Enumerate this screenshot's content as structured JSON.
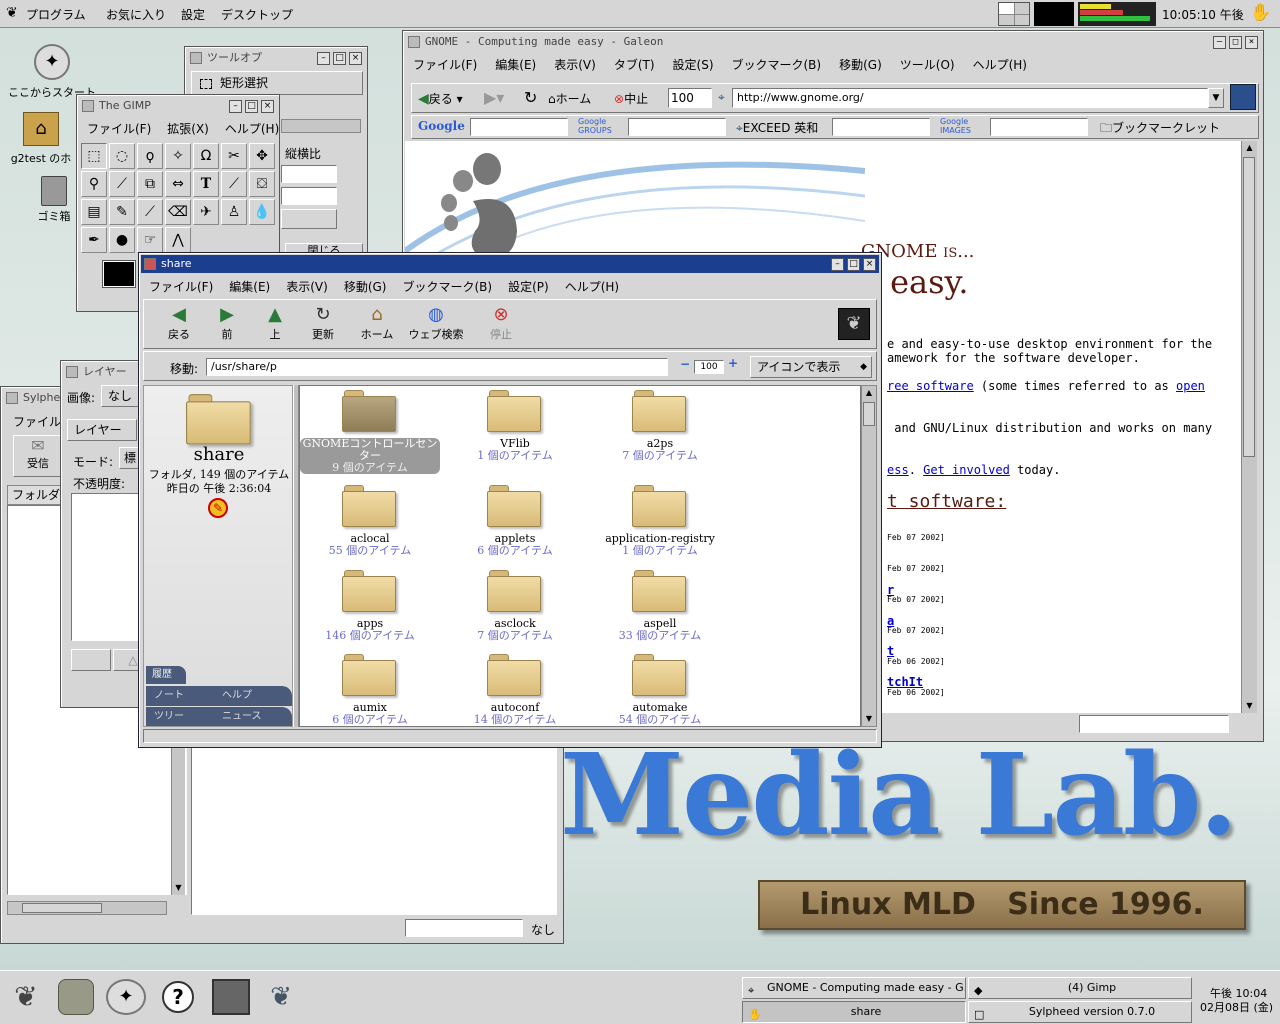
{
  "top_panel": {
    "menus": [
      "プログラム",
      "お気に入り",
      "設定",
      "デスクトップ"
    ],
    "clock": "10:05:10 午後"
  },
  "desktop": {
    "icons": [
      "ここからスタート",
      "g2test のホ",
      "ゴミ箱"
    ],
    "wallpaper_title": "Media Lab.",
    "wallpaper_plate": "Linux MLD   Since 1996."
  },
  "galeon": {
    "title": "GNOME - Computing made easy - Galeon",
    "menus": [
      "ファイル(F)",
      "編集(E)",
      "表示(V)",
      "タブ(T)",
      "設定(S)",
      "ブックマーク(B)",
      "移動(G)",
      "ツール(O)",
      "ヘルプ(H)"
    ],
    "back": "戻る",
    "home": "ホーム",
    "stop": "中止",
    "zoom": "100",
    "url": "http://www.gnome.org/",
    "search_bar": {
      "google": "Google",
      "google_groups": "Google GROUPS",
      "exceed": "EXCEED 英和",
      "google_images": "Google IMAGES",
      "bookmarklet": "ブックマークレット"
    },
    "content": {
      "heading": "GNOME is...",
      "heading2": "e easy.",
      "line1": "e and easy-to-use desktop environment for the",
      "line2": "amework for the software developer.",
      "line3_link": "ree software",
      "line3_rest": " (some times referred to as ",
      "line3_link2": "open",
      "line4": " and GNU/Linux distribution and works on many",
      "line5_link": "ess",
      "line5_mid": ". ",
      "line5_link2": "Get involved",
      "line5_rest": " today.",
      "section": "t software:",
      "dates": [
        "Feb 07 2002]",
        "Feb 07 2002]",
        "Feb 07 2002]",
        "Feb 07 2002]",
        "Feb 06 2002]",
        "Feb 06 2002]"
      ],
      "news_links": [
        "r",
        "a",
        "t",
        "tchIt"
      ]
    }
  },
  "gimp_toolopts": {
    "title": "ツールオプ",
    "rect_select": "矩形選択",
    "aspect": "縦横比",
    "close": "閉じる"
  },
  "gimp": {
    "title": "The GIMP",
    "menus": [
      "ファイル(F)",
      "拡張(X)",
      "ヘルプ(H)"
    ]
  },
  "layers": {
    "title": "レイヤー",
    "image_label": "画像:",
    "image_value": "なし",
    "layer_tab": "レイヤー",
    "mode_label": "モード:",
    "mode_value": "標",
    "opacity_label": "不透明度:"
  },
  "sylpheed": {
    "title": "Sylphe",
    "file_menu": "ファイル",
    "receive": "受信",
    "folder": "フォルダ",
    "status": "なし"
  },
  "nautilus": {
    "title": "share",
    "menus": [
      "ファイル(F)",
      "編集(E)",
      "表示(V)",
      "移動(G)",
      "ブックマーク(B)",
      "設定(P)",
      "ヘルプ(H)"
    ],
    "toolbar": [
      "戻る",
      "前",
      "上",
      "更新",
      "ホーム",
      "ウェブ検索",
      "停止"
    ],
    "location_label": "移動:",
    "location": "/usr/share/p",
    "zoom": "100",
    "view_mode": "アイコンで表示",
    "sidebar": {
      "name": "share",
      "info": "フォルダ, 149 個のアイテム",
      "date": "昨日の 午後 2:36:04",
      "tabs": [
        "履歴",
        "ノート",
        "ヘルプ",
        "ツリー",
        "ニュース"
      ]
    },
    "items": [
      {
        "name": "GNOMEコントロールセンター",
        "count": "9 個のアイテム"
      },
      {
        "name": "VFlib",
        "count": "1 個のアイテム"
      },
      {
        "name": "a2ps",
        "count": "7 個のアイテム"
      },
      {
        "name": "aclocal",
        "count": "55 個のアイテム"
      },
      {
        "name": "applets",
        "count": "6 個のアイテム"
      },
      {
        "name": "application-registry",
        "count": "1 個のアイテム"
      },
      {
        "name": "apps",
        "count": "146 個のアイテム"
      },
      {
        "name": "asclock",
        "count": "7 個のアイテム"
      },
      {
        "name": "aspell",
        "count": "33 個のアイテム"
      },
      {
        "name": "aumix",
        "count": "6 個のアイテム"
      },
      {
        "name": "autoconf",
        "count": "14 個のアイテム"
      },
      {
        "name": "automake",
        "count": "54 個のアイテム"
      }
    ]
  },
  "taskbar": {
    "tasks": [
      "GNOME - Computing made easy - G...",
      "(4) Gimp",
      "share",
      "Sylpheed version 0.7.0"
    ],
    "time": "午後 10:04",
    "date": "02月08日 (金)"
  },
  "colors": {
    "active_title": "#1c3e8e",
    "panel": "#d6d6d6",
    "link": "#0000cc",
    "media_lab": "#3a7ad6",
    "folder_count": "#6b6bc8"
  }
}
